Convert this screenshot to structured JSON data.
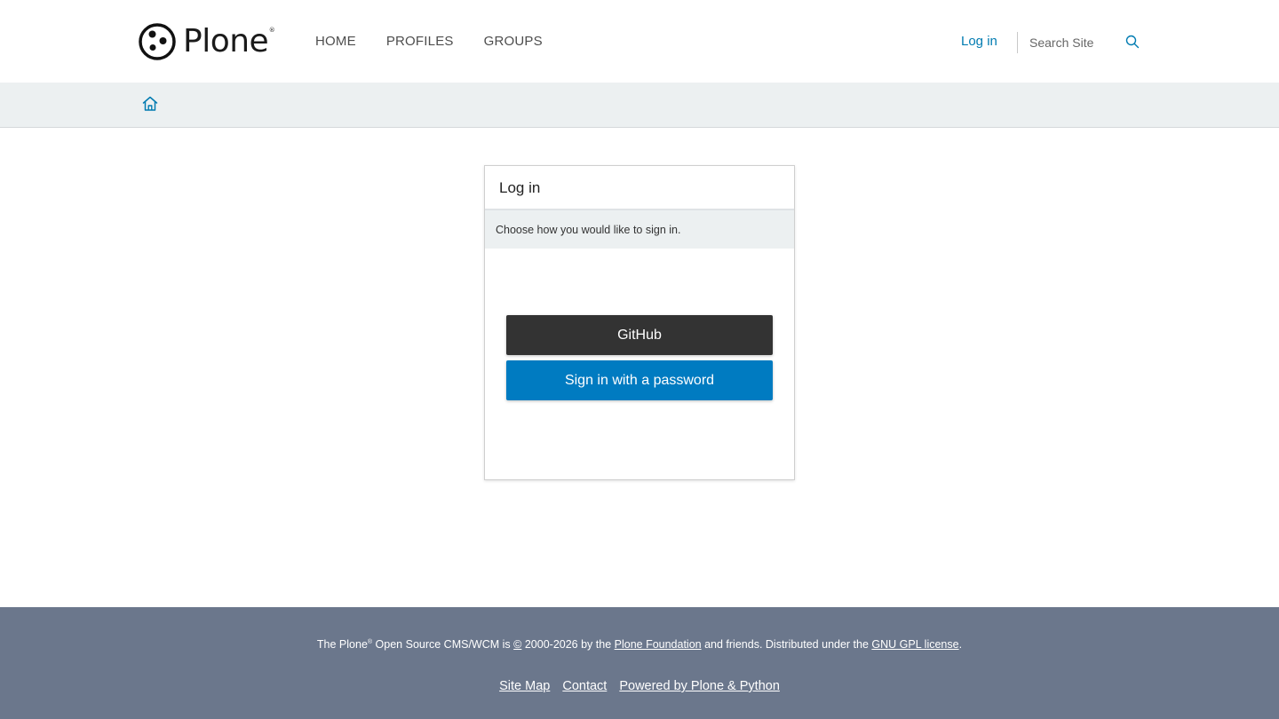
{
  "header": {
    "logo_text": "Plone",
    "logo_reg": "®",
    "nav": [
      "HOME",
      "PROFILES",
      "GROUPS"
    ],
    "login_label": "Log in",
    "search_placeholder": "Search Site"
  },
  "colors": {
    "accent": "#007bb1",
    "breadcrumb_bg": "#ecf0f1",
    "github_button": "#333333",
    "password_button": "#007bc1",
    "footer_bg": "#6b778c"
  },
  "login": {
    "title": "Log in",
    "description": "Choose how you would like to sign in.",
    "github_label": "GitHub",
    "password_label": "Sign in with a password"
  },
  "footer": {
    "copyright": {
      "prefix": "The Plone",
      "reg": "®",
      "mid": " Open Source CMS/WCM is ",
      "copy_symbol": "©",
      "years": " 2000-2026 by the ",
      "foundation_link": "Plone Foundation",
      "mid2": " and friends. Distributed under the ",
      "license_link": "GNU GPL license",
      "suffix": "."
    },
    "links": [
      "Site Map",
      "Contact",
      "Powered by Plone & Python"
    ]
  },
  "icons": {
    "logo": "plone-logo-icon",
    "search": "search-icon",
    "home": "home-icon"
  }
}
